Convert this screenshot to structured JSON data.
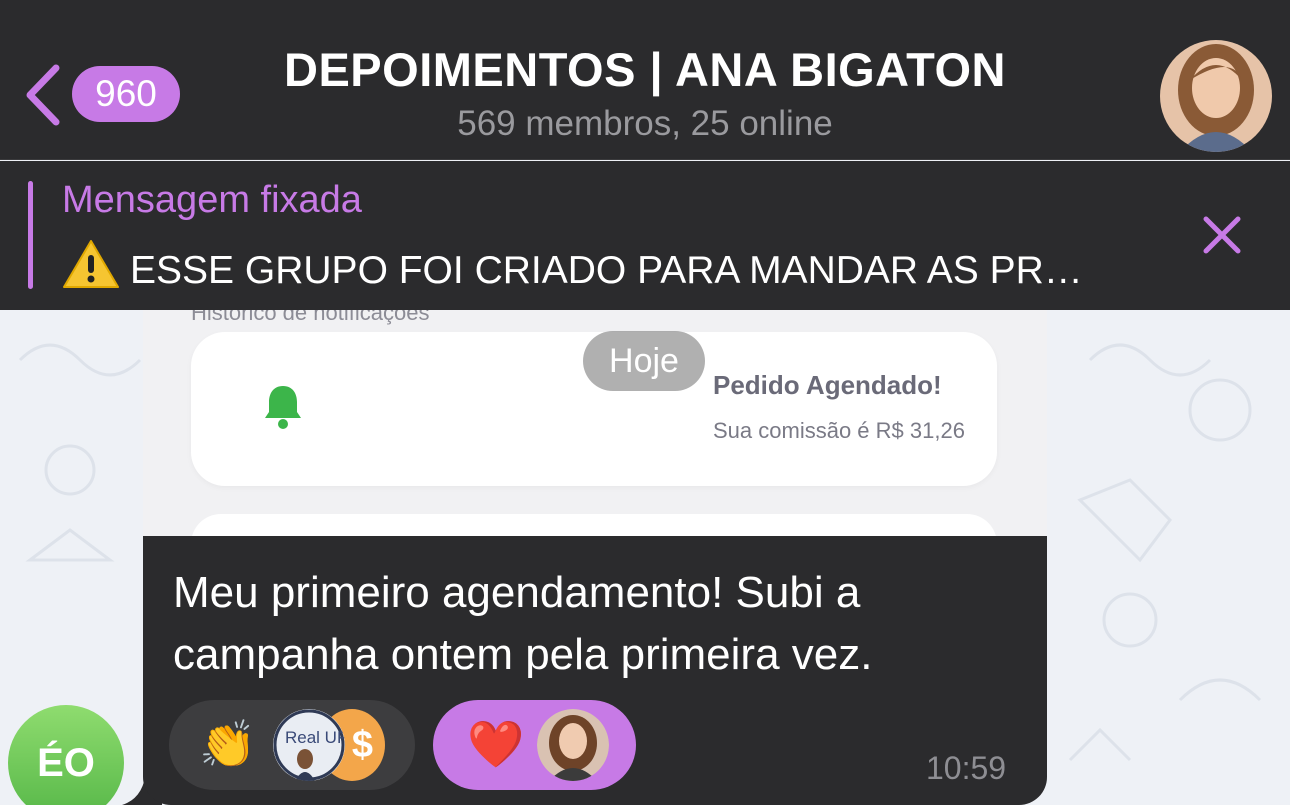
{
  "header": {
    "back_count": "960",
    "title": "DEPOIMENTOS | ANA BIGATON",
    "subtitle": "569 membros, 25 online"
  },
  "pinned": {
    "label": "Mensagem fixada",
    "text": "ESSE GRUPO FOI CRIADO PARA MANDAR AS PR…"
  },
  "message": {
    "screenshot": {
      "caption": "Histórico de notificações",
      "notification_title": "Pedido Agendado!",
      "notification_body": "Sua comissão é R$ 31,26"
    },
    "date_chip": "Hoje",
    "text": "Meu primeiro agendamento! Subi a campanha ontem pela primeira vez.",
    "time": "10:59",
    "reactions": [
      {
        "emoji": "👏",
        "avatar_text": "Real UP",
        "coin_text": "$"
      },
      {
        "emoji": "❤️"
      }
    ]
  },
  "sender": {
    "initials": "ÉO"
  },
  "colors": {
    "accent": "#c77ae6",
    "bar": "#2b2b2d",
    "bubble": "#2b2b2d",
    "bell": "#3cb54a"
  }
}
